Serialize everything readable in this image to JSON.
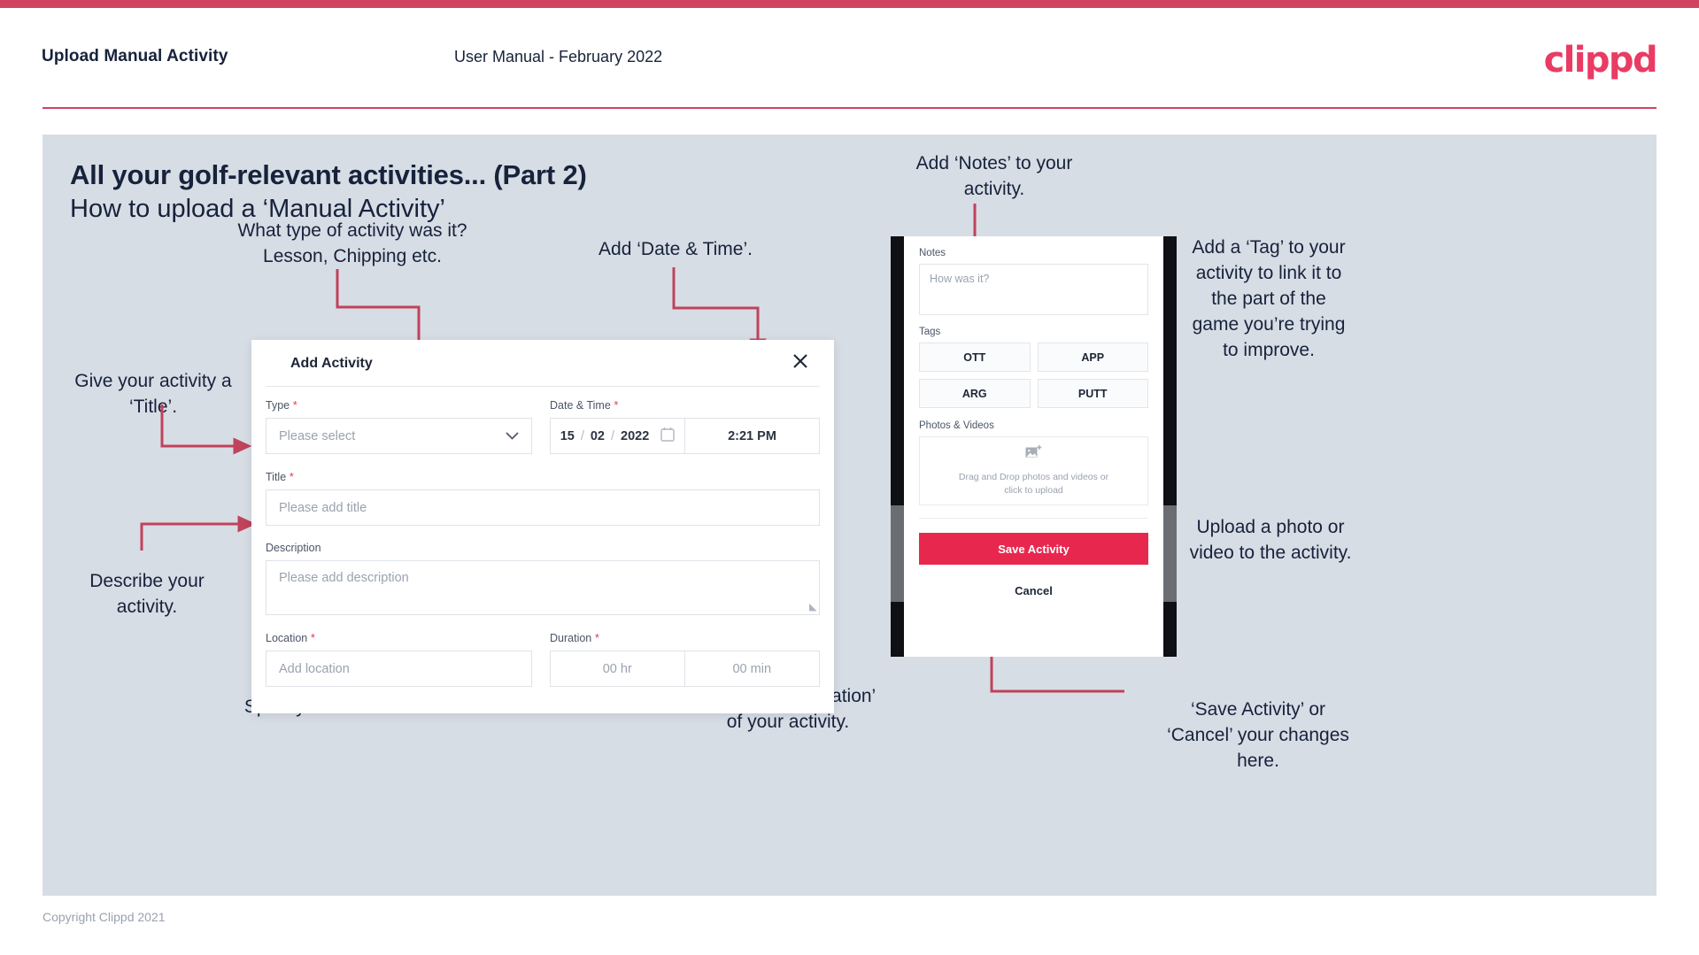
{
  "theme": {
    "accent": "#cf4361",
    "brand_pink": "#e93b63",
    "save_button": "#e8274f",
    "slide_bg": "#d7dde5",
    "text_dark": "#17223b",
    "arrow_color": "#c0425b"
  },
  "header": {
    "title": "Upload Manual Activity",
    "subtitle": "User Manual - February 2022",
    "logo": "clippd"
  },
  "slide": {
    "title": "All your golf-relevant activities... (Part 2)",
    "subtitle": "How to upload a ‘Manual Activity’"
  },
  "dialog": {
    "title": "Add Activity",
    "close_icon": "close-icon",
    "fields": {
      "type": {
        "label": "Type",
        "required": true,
        "placeholder": "Please select",
        "chevron": "⌄"
      },
      "datetime": {
        "label": "Date & Time",
        "required": true,
        "day": "15",
        "month": "02",
        "year": "2022",
        "separator": "/",
        "time": "2:21 PM",
        "calendar_icon": "calendar-icon"
      },
      "title": {
        "label": "Title",
        "required": true,
        "placeholder": "Please add title"
      },
      "description": {
        "label": "Description",
        "required": false,
        "placeholder": "Please add description"
      },
      "location": {
        "label": "Location",
        "required": true,
        "placeholder": "Add location"
      },
      "duration": {
        "label": "Duration",
        "required": true,
        "hours_placeholder": "00 hr",
        "minutes_placeholder": "00 min"
      }
    }
  },
  "phone": {
    "notes": {
      "label": "Notes",
      "placeholder": "How was it?"
    },
    "tags": {
      "label": "Tags",
      "items": [
        "OTT",
        "APP",
        "ARG",
        "PUTT"
      ]
    },
    "photos": {
      "label": "Photos & Videos",
      "icon": "add-image-icon",
      "drop_text": "Drag and Drop photos and videos or\nclick to upload"
    },
    "save_label": "Save Activity",
    "cancel_label": "Cancel"
  },
  "annotations": [
    {
      "id": "type-note",
      "text": "What type of activity was it?\nLesson, Chipping etc."
    },
    {
      "id": "datetime-note",
      "text": "Add ‘Date & Time’."
    },
    {
      "id": "title-note",
      "text": "Give your activity a\n‘Title’."
    },
    {
      "id": "description-note",
      "text": "Describe your\nactivity."
    },
    {
      "id": "location-note",
      "text": "Specify the ‘Location’."
    },
    {
      "id": "duration-note",
      "text": "Specify the ‘Duration’\nof your activity."
    },
    {
      "id": "notes-note",
      "text": "Add ‘Notes’ to your\nactivity."
    },
    {
      "id": "tags-note",
      "text": "Add a ‘Tag’ to your\nactivity to link it to\nthe part of the\ngame you’re trying\nto improve."
    },
    {
      "id": "upload-note",
      "text": "Upload a photo or\nvideo to the activity."
    },
    {
      "id": "save-note",
      "text": "‘Save Activity’ or\n‘Cancel’ your changes\nhere."
    }
  ],
  "footer": {
    "copyright": "Copyright Clippd 2021"
  }
}
